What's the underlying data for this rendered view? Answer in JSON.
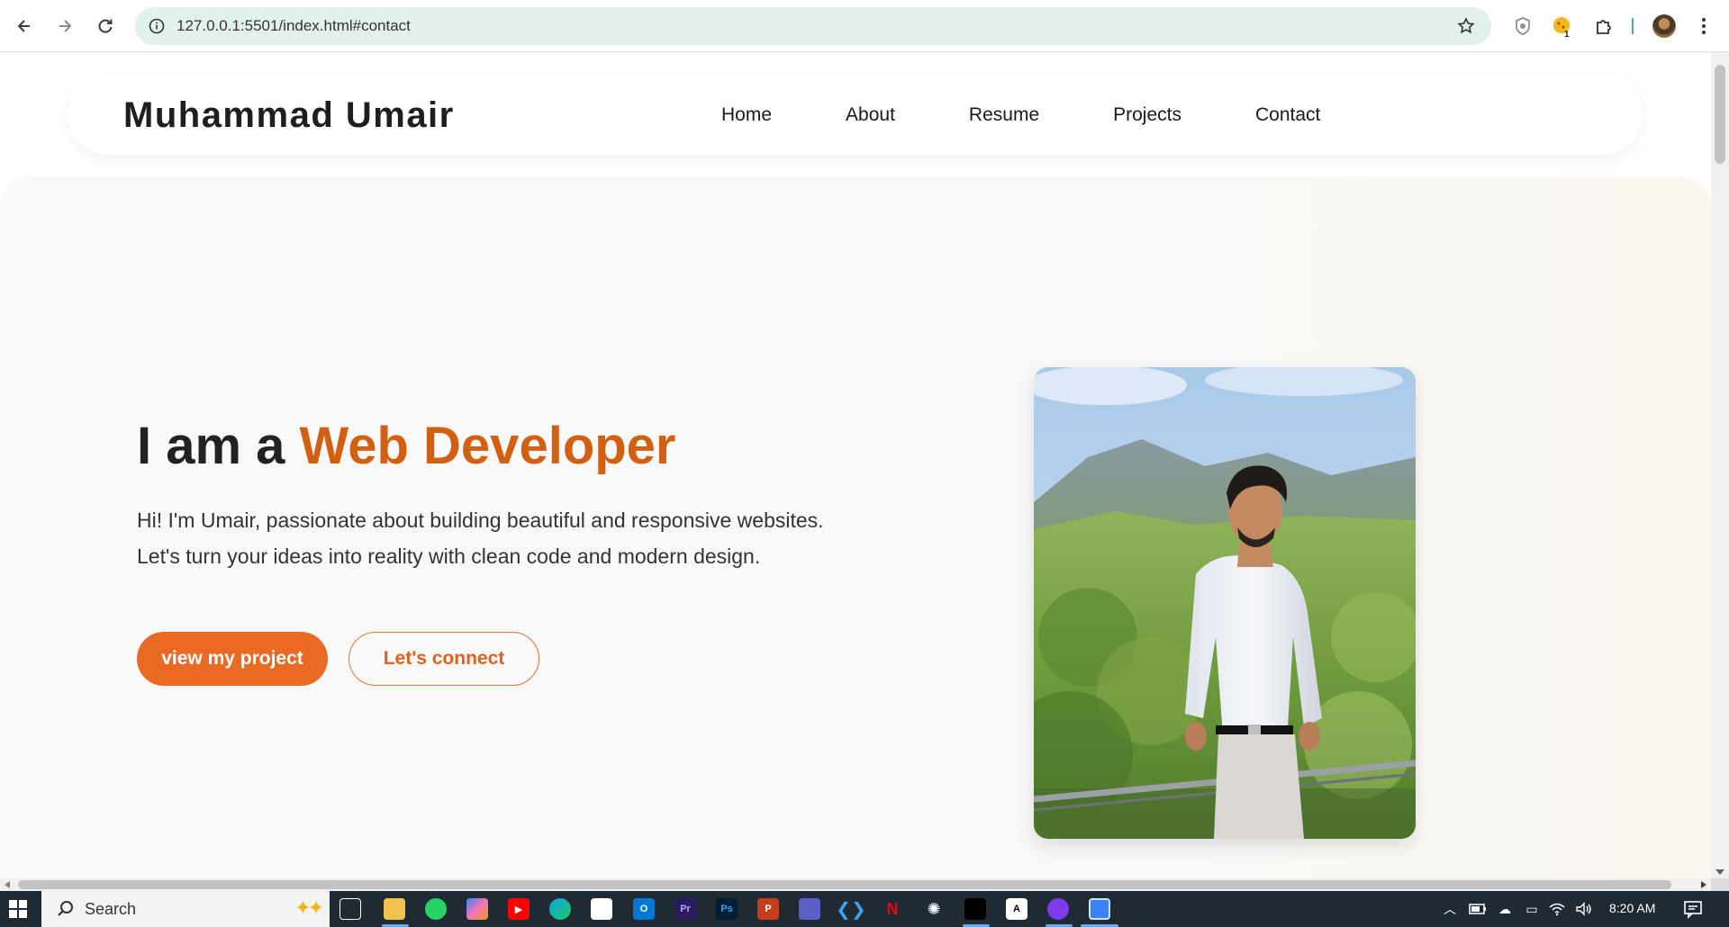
{
  "browser": {
    "url": "127.0.0.1:5501/index.html#contact",
    "extension_badge": "1"
  },
  "site": {
    "brand": "Muhammad Umair",
    "nav": [
      "Home",
      "About",
      "Resume",
      "Projects",
      "Contact"
    ]
  },
  "hero": {
    "headline_prefix": "I am a ",
    "headline_accent": "Web Developer",
    "intro_line1": "Hi! I'm Umair, passionate about building beautiful and responsive websites.",
    "intro_line2": "Let's turn your ideas into reality with clean code and modern design.",
    "primary_button": "view my project",
    "secondary_button": "Let's connect",
    "accent_color": "#d35f11"
  },
  "taskbar": {
    "search_label": "Search",
    "time": "8:20 AM",
    "apps": [
      "task-view",
      "file-explorer",
      "whatsapp",
      "copilot",
      "youtube",
      "edge",
      "microsoft-store",
      "outlook",
      "premiere-pro",
      "photoshop",
      "powerpoint",
      "teams",
      "vs-code",
      "netflix",
      "chatgpt",
      "capcut",
      "text-editor",
      "github-desktop",
      "active-window"
    ]
  }
}
